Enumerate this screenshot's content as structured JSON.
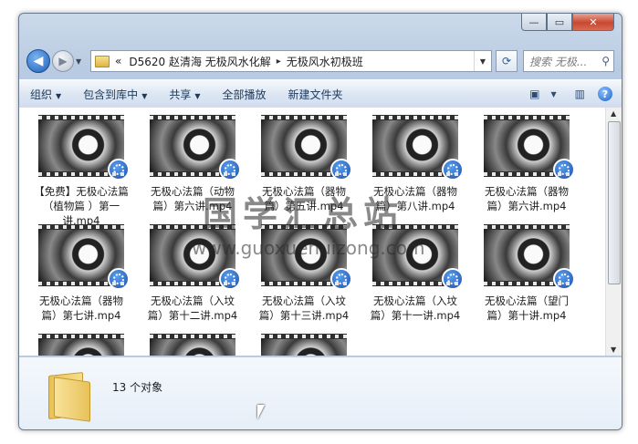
{
  "window": {
    "min_glyph": "—",
    "max_glyph": "▭",
    "close_glyph": "✕"
  },
  "address": {
    "chevrons": "«",
    "crumbs": [
      "D5620 赵清海 无极风水化解",
      "无极风水初极班"
    ],
    "separator": "▸"
  },
  "search": {
    "placeholder": "搜索 无极..."
  },
  "toolbar": {
    "organize": "组织",
    "include_in_library": "包含到库中",
    "share": "共享",
    "play_all": "全部播放",
    "new_folder": "新建文件夹"
  },
  "files": [
    {
      "name": "【免费】无极心法篇（植物篇 ）第一讲.mp4"
    },
    {
      "name": "无极心法篇（动物篇）第六讲.mp4"
    },
    {
      "name": "无极心法篇（器物篇）第五讲.mp4"
    },
    {
      "name": "无极心法篇（器物篇）第八讲.mp4"
    },
    {
      "name": "无极心法篇（器物篇）第六讲.mp4"
    },
    {
      "name": "无极心法篇（器物篇）第七讲.mp4"
    },
    {
      "name": "无极心法篇（入坟篇）第十二讲.mp4"
    },
    {
      "name": "无极心法篇（入坟篇）第十三讲.mp4"
    },
    {
      "name": "无极心法篇（入坟篇）第十一讲.mp4"
    },
    {
      "name": "无极心法篇（望门篇）第十讲.mp4"
    },
    {
      "name": ""
    },
    {
      "name": ""
    },
    {
      "name": ""
    }
  ],
  "status": {
    "count_text": "13 个对象"
  },
  "watermark": {
    "line1": "国学汇总站",
    "line2": "www.guoxuehuizong.com"
  },
  "colors": {
    "accent": "#1f63c4",
    "close": "#c9472f"
  },
  "icons": {
    "back": "arrow-left-icon",
    "forward": "arrow-right-icon",
    "search": "magnifier-icon",
    "help": "help-icon",
    "folder": "folder-icon",
    "video": "video-badge-icon"
  }
}
